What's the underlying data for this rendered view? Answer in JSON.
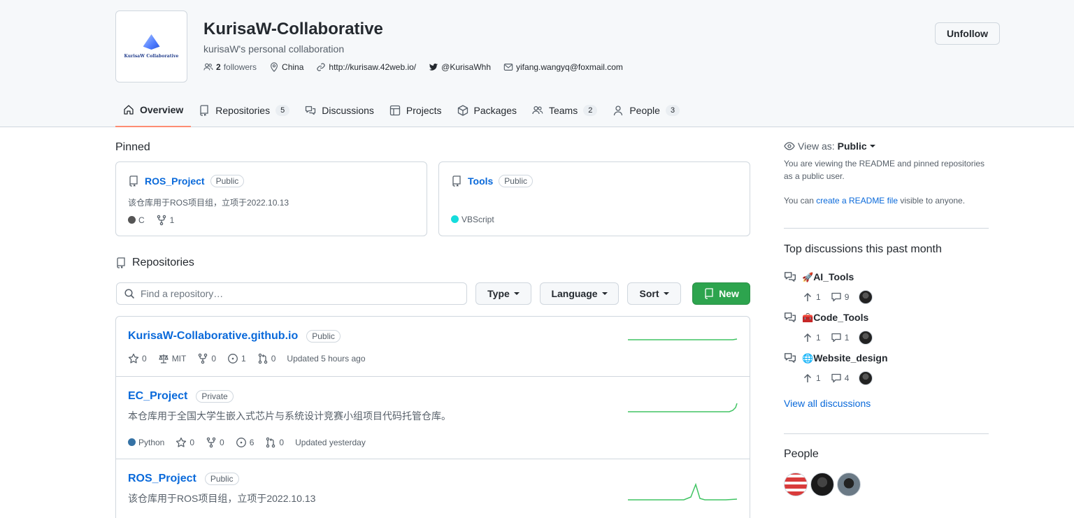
{
  "org": {
    "name": "KurisaW-Collaborative",
    "description": "kurisaW's personal collaboration",
    "logo_text": "KurisaW Collaborative",
    "followers_count": "2",
    "followers_label": "followers",
    "location": "China",
    "website": "http://kurisaw.42web.io/",
    "twitter": "@KurisaWhh",
    "email": "yifang.wangyq@foxmail.com",
    "unfollow_label": "Unfollow"
  },
  "tabs": [
    {
      "label": "Overview",
      "count": null,
      "icon": "home-icon"
    },
    {
      "label": "Repositories",
      "count": "5",
      "icon": "repo-icon"
    },
    {
      "label": "Discussions",
      "count": null,
      "icon": "comment-discussion-icon"
    },
    {
      "label": "Projects",
      "count": null,
      "icon": "table-icon"
    },
    {
      "label": "Packages",
      "count": null,
      "icon": "package-icon"
    },
    {
      "label": "Teams",
      "count": "2",
      "icon": "people-icon"
    },
    {
      "label": "People",
      "count": "3",
      "icon": "person-icon"
    }
  ],
  "pinned": {
    "title": "Pinned",
    "items": [
      {
        "name": "ROS_Project",
        "visibility": "Public",
        "description": "该仓库用于ROS项目组，立项于2022.10.13",
        "language": "C",
        "language_color": "#555555",
        "forks": "1"
      },
      {
        "name": "Tools",
        "visibility": "Public",
        "description": "",
        "language": "VBScript",
        "language_color": "#15dcdc",
        "forks": ""
      }
    ]
  },
  "repositories": {
    "title": "Repositories",
    "search_placeholder": "Find a repository…",
    "type_label": "Type",
    "language_label": "Language",
    "sort_label": "Sort",
    "new_label": "New",
    "items": [
      {
        "name": "KurisaW-Collaborative.github.io",
        "visibility": "Public",
        "description": "",
        "language": "",
        "stars": "0",
        "license": "MIT",
        "forks": "0",
        "issues": "1",
        "pulls": "0",
        "updated": "Updated 5 hours ago"
      },
      {
        "name": "EC_Project",
        "visibility": "Private",
        "description": "本仓库用于全国大学生嵌入式芯片与系统设计竞赛小组项目代码托管仓库。",
        "language": "Python",
        "language_color": "#3572A5",
        "stars": "0",
        "forks": "0",
        "issues": "6",
        "pulls": "0",
        "updated": "Updated yesterday"
      },
      {
        "name": "ROS_Project",
        "visibility": "Public",
        "description": "该仓库用于ROS项目组，立项于2022.10.13",
        "language": "",
        "stars": "",
        "forks": "",
        "issues": "",
        "pulls": "",
        "updated": ""
      }
    ]
  },
  "sidebar": {
    "view_as_label": "View as:",
    "view_as_value": "Public",
    "view_info": "You are viewing the README and pinned repositories as a public user.",
    "readme_prefix": "You can",
    "readme_link": "create a README file",
    "readme_suffix": "visible to anyone.",
    "discussions_title": "Top discussions this past month",
    "discussions": [
      {
        "emoji": "🚀",
        "title": "AI_Tools",
        "upvotes": "1",
        "comments": "9"
      },
      {
        "emoji": "🧰",
        "title": "Code_Tools",
        "upvotes": "1",
        "comments": "1"
      },
      {
        "emoji": "🌐",
        "title": "Website_design",
        "upvotes": "1",
        "comments": "4"
      }
    ],
    "view_all": "View all discussions",
    "people_title": "People"
  },
  "colors": {
    "accent_link": "#0969da",
    "tab_underline": "#fd8c73",
    "new_button": "#2da44e",
    "sparkline": "#40c463"
  }
}
